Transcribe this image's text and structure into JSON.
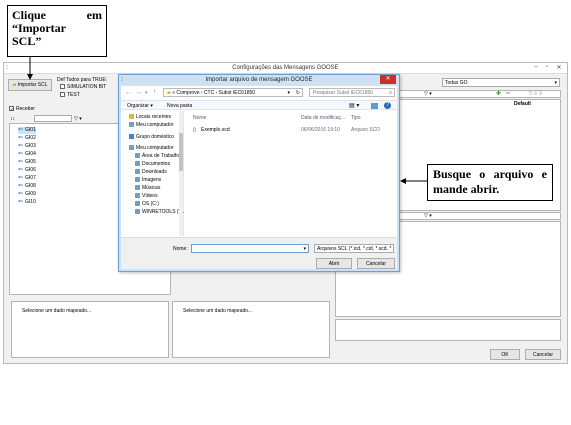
{
  "callouts": {
    "import_hint_line1_a": "Clique",
    "import_hint_line1_b": "em",
    "import_hint_line2": "“Importar",
    "import_hint_line3": "SCL”",
    "browse_hint": "Busque o arquivo e mande abrir."
  },
  "main_window": {
    "title": "Configurações das Mensagens GOOSE",
    "import_scl_button": "Importar SCL",
    "def_todos_label": "Def Todos para TRUE:",
    "simulation_bit_label": "SIMULATION BIT",
    "test_label": "TEST",
    "receber_label": "Receber",
    "todas_go_value": "Todas GO",
    "default_column": "Default",
    "tree_items": [
      "GI01",
      "GI02",
      "GI03",
      "GI04",
      "GI05",
      "GI06",
      "GI07",
      "GI08",
      "GI09",
      "GI10"
    ],
    "select_mapped_left": "Selecione um dado mapeado...",
    "select_mapped_right": "Selecione um dado mapeado...",
    "ok_button": "OK",
    "cancel_button": "Cancelar"
  },
  "dialog": {
    "title": "Importar arquivo de mensagem GOOSE",
    "breadcrumb": [
      "« Comprove",
      "CTC",
      "Subst IEC61850"
    ],
    "search_placeholder": "Pesquisar Subst IEC61850",
    "organize_label": "Organizar ▾",
    "new_folder_label": "Nova pasta",
    "nav_items": [
      "Locais recentes",
      "Meu computador",
      "Grupo doméstico",
      "Meu computador",
      "Área de Trabalho",
      "Documentos",
      "Downloads",
      "Imagens",
      "Músicas",
      "Vídeos",
      "OS (C:)",
      "WINRETOOLS (\\..."
    ],
    "columns": {
      "name": "Nome",
      "date": "Data de modificaç...",
      "type": "Tipo"
    },
    "files": [
      {
        "name": "Exemplo.scd",
        "date": "06/06/2016 19:10",
        "type": "Arquivo SCD"
      }
    ],
    "filename_label": "Nome:",
    "filename_value": "",
    "filetype_value": "Arquivos SCL (*.icd, *.cid, *.scd, *",
    "open_button": "Abrir",
    "cancel_button": "Cancelar"
  },
  "colors": {
    "dialog_frame": "#cfe2f3",
    "close_button": "#c9302c",
    "tree_arrow": "#2a6ab8"
  }
}
